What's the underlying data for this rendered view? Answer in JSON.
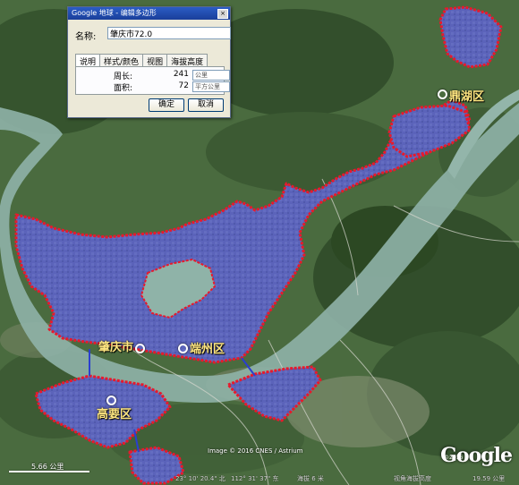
{
  "window": {
    "title": "Google 地球 - 编辑多边形",
    "close_glyph": "×"
  },
  "dialog": {
    "name_label": "名称:",
    "name_value": "肇庆市72.0",
    "tabs": [
      "说明",
      "样式/颜色",
      "视图",
      "海拔高度"
    ],
    "active_tab_index": 0,
    "perimeter_label": "周长:",
    "perimeter_value": "241",
    "perimeter_unit": "公里",
    "area_label": "面积:",
    "area_value": "72",
    "area_unit": "平方公里",
    "ok_label": "确定",
    "cancel_label": "取消"
  },
  "places": {
    "dinghu": "鼎湖区",
    "zhaoqing": "肇庆市",
    "duanzhou": "端州区",
    "gaoyao": "高要区"
  },
  "map": {
    "copyright": "Image © 2016 CNES / Astrium",
    "scale_label": "5.66 公里",
    "footer_lat": "23° 10' 20.4\" 北",
    "footer_lon": "112° 31' 37\" 东",
    "footer_alt": "海拔 6 米",
    "footer_eye": "视角海拔高度",
    "footer_eye_value": "19.59 公里",
    "logo": "Google",
    "logo_year": "©2016",
    "colors": {
      "boundary": "#e8192c",
      "urban_fill": "#5860b8",
      "river": "#8fb3a8",
      "terrain": "#3b5a35"
    }
  }
}
